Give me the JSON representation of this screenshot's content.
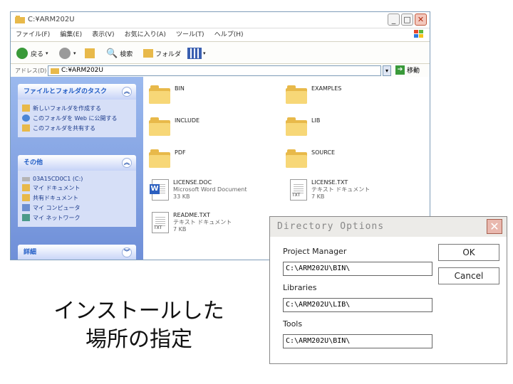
{
  "explorer": {
    "title": "C:¥ARM202U",
    "menu": [
      "ファイル(F)",
      "編集(E)",
      "表示(V)",
      "お気に入り(A)",
      "ツール(T)",
      "ヘルプ(H)"
    ],
    "toolbar": {
      "back": "戻る",
      "search": "検索",
      "folders": "フォルダ"
    },
    "address_label": "アドレス(D)",
    "address_value": "C:¥ARM202U",
    "go_label": "移動",
    "tasks": {
      "file_folder_title": "ファイルとフォルダのタスク",
      "file_folder_items": [
        "新しいフォルダを作成する",
        "このフォルダを Web に公開する",
        "このフォルダを共有する"
      ],
      "other_title": "その他",
      "other_items": [
        "03A15CD0C1 (C:)",
        "マイ ドキュメント",
        "共有ドキュメント",
        "マイ コンピュータ",
        "マイ ネットワーク"
      ],
      "details_title": "詳細"
    },
    "files": [
      {
        "name": "BIN",
        "kind": "folder"
      },
      {
        "name": "EXAMPLES",
        "kind": "folder"
      },
      {
        "name": "INCLUDE",
        "kind": "folder"
      },
      {
        "name": "LIB",
        "kind": "folder"
      },
      {
        "name": "PDF",
        "kind": "folder"
      },
      {
        "name": "SOURCE",
        "kind": "folder"
      },
      {
        "name": "LICENSE.DOC",
        "kind": "word",
        "type": "Microsoft Word Document",
        "size": "33 KB"
      },
      {
        "name": "LICENSE.TXT",
        "kind": "txt",
        "type": "テキスト ドキュメント",
        "size": "7 KB"
      },
      {
        "name": "README.TXT",
        "kind": "txt",
        "type": "テキスト ドキュメント",
        "size": "7 KB"
      }
    ]
  },
  "dialog": {
    "title": "Directory Options",
    "project_manager_label": "Project Manager",
    "project_manager_value": "C:\\ARM202U\\BIN\\",
    "libraries_label": "Libraries",
    "libraries_value": "C:\\ARM202U\\LIB\\",
    "tools_label": "Tools",
    "tools_value": "C:\\ARM202U\\BIN\\",
    "ok_label": "OK",
    "cancel_label": "Cancel"
  },
  "caption": {
    "line1": "インストールした",
    "line2": "場所の指定"
  }
}
